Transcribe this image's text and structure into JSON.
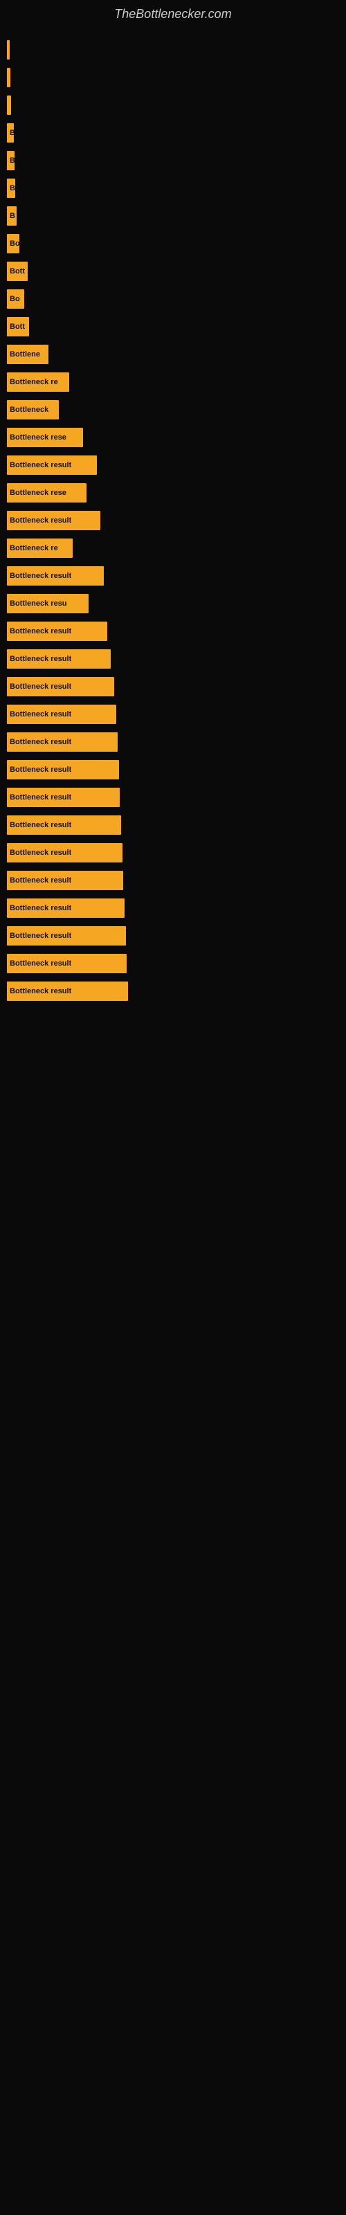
{
  "site": {
    "title": "TheBottlenecker.com"
  },
  "bars": [
    {
      "id": 1,
      "label": "",
      "width": 4
    },
    {
      "id": 2,
      "label": "",
      "width": 5
    },
    {
      "id": 3,
      "label": "",
      "width": 6
    },
    {
      "id": 4,
      "label": "B",
      "width": 10
    },
    {
      "id": 5,
      "label": "B",
      "width": 11
    },
    {
      "id": 6,
      "label": "B",
      "width": 12
    },
    {
      "id": 7,
      "label": "B",
      "width": 14
    },
    {
      "id": 8,
      "label": "Bo",
      "width": 18
    },
    {
      "id": 9,
      "label": "Bott",
      "width": 30
    },
    {
      "id": 10,
      "label": "Bo",
      "width": 25
    },
    {
      "id": 11,
      "label": "Bott",
      "width": 32
    },
    {
      "id": 12,
      "label": "Bottlene",
      "width": 60
    },
    {
      "id": 13,
      "label": "Bottleneck re",
      "width": 90
    },
    {
      "id": 14,
      "label": "Bottleneck",
      "width": 75
    },
    {
      "id": 15,
      "label": "Bottleneck rese",
      "width": 110
    },
    {
      "id": 16,
      "label": "Bottleneck result",
      "width": 130
    },
    {
      "id": 17,
      "label": "Bottleneck rese",
      "width": 115
    },
    {
      "id": 18,
      "label": "Bottleneck result",
      "width": 135
    },
    {
      "id": 19,
      "label": "Bottleneck re",
      "width": 95
    },
    {
      "id": 20,
      "label": "Bottleneck result",
      "width": 140
    },
    {
      "id": 21,
      "label": "Bottleneck resu",
      "width": 118
    },
    {
      "id": 22,
      "label": "Bottleneck result",
      "width": 145
    },
    {
      "id": 23,
      "label": "Bottleneck result",
      "width": 150
    },
    {
      "id": 24,
      "label": "Bottleneck result",
      "width": 155
    },
    {
      "id": 25,
      "label": "Bottleneck result",
      "width": 158
    },
    {
      "id": 26,
      "label": "Bottleneck result",
      "width": 160
    },
    {
      "id": 27,
      "label": "Bottleneck result",
      "width": 162
    },
    {
      "id": 28,
      "label": "Bottleneck result",
      "width": 163
    },
    {
      "id": 29,
      "label": "Bottleneck result",
      "width": 165
    },
    {
      "id": 30,
      "label": "Bottleneck result",
      "width": 167
    },
    {
      "id": 31,
      "label": "Bottleneck result",
      "width": 168
    },
    {
      "id": 32,
      "label": "Bottleneck result",
      "width": 170
    },
    {
      "id": 33,
      "label": "Bottleneck result",
      "width": 172
    },
    {
      "id": 34,
      "label": "Bottleneck result",
      "width": 173
    },
    {
      "id": 35,
      "label": "Bottleneck result",
      "width": 175
    }
  ]
}
